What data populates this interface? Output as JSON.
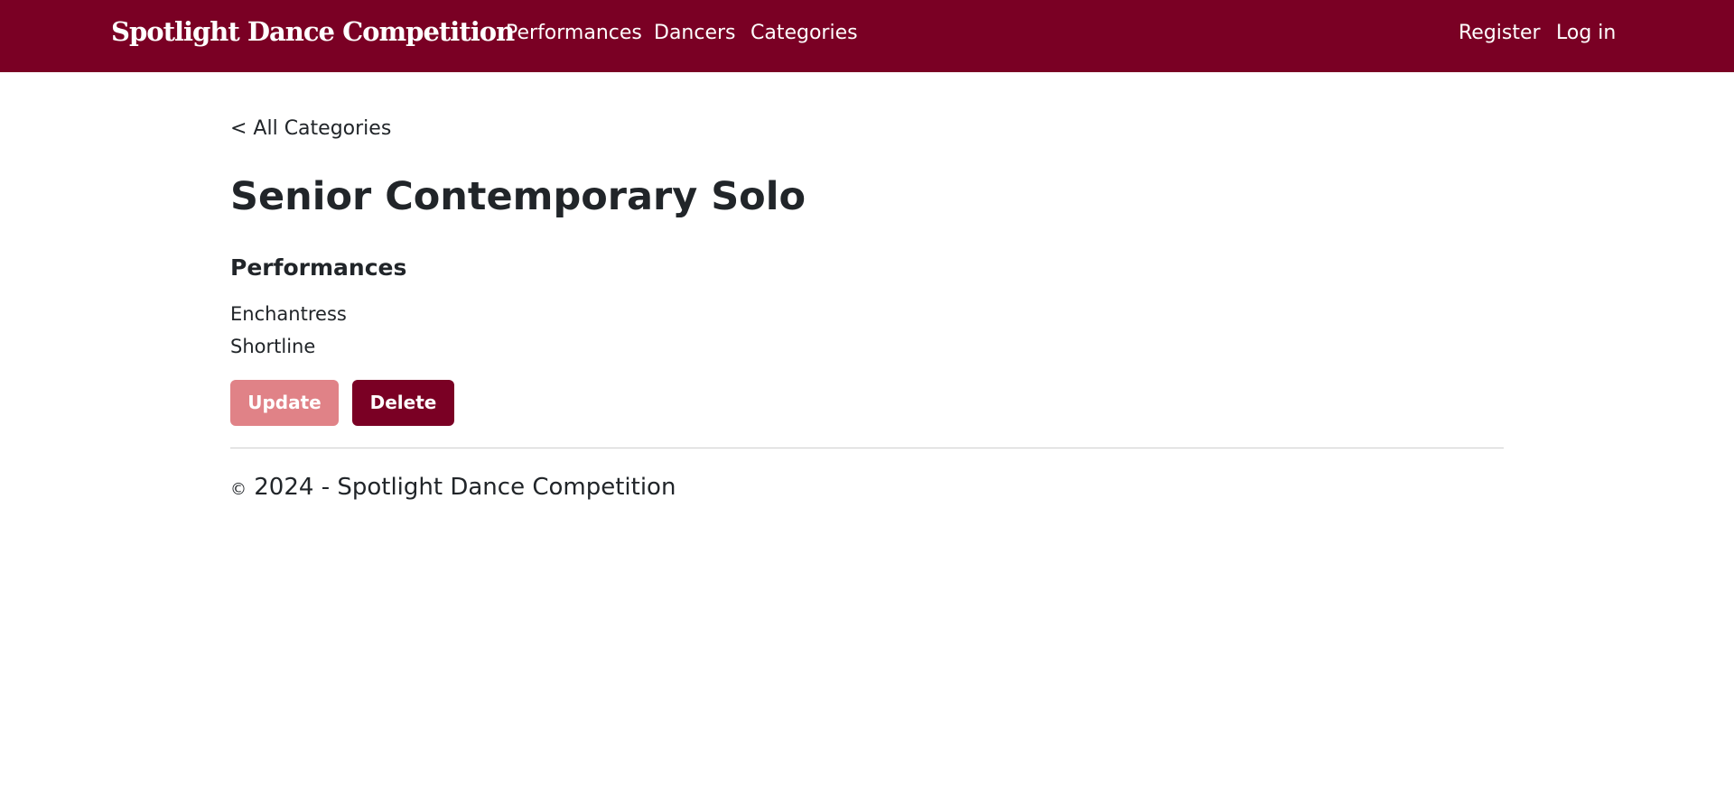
{
  "brand": "Spotlight Dance Competition",
  "nav": {
    "left": [
      "Performances",
      "Dancers",
      "Categories"
    ],
    "right": [
      "Register",
      "Log in"
    ]
  },
  "back_link": "< All Categories",
  "title": "Senior Contemporary Solo",
  "section_heading": "Performances",
  "performances": [
    "Enchantress",
    "Shortline"
  ],
  "buttons": {
    "update": "Update",
    "delete": "Delete"
  },
  "footer": {
    "copyright_symbol": "©",
    "text": " 2024 - Spotlight Dance Competition"
  },
  "colors": {
    "brand": "#7a0024",
    "update_button": "#e08287",
    "delete_button": "#7a0024"
  }
}
